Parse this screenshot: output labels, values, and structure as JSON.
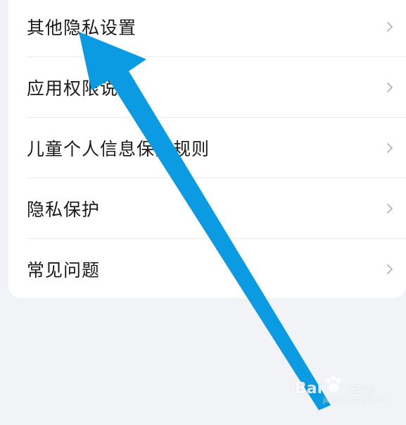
{
  "menu": {
    "items": [
      {
        "label": "其他隐私设置"
      },
      {
        "label": "应用权限说明"
      },
      {
        "label": "儿童个人信息保护规则"
      },
      {
        "label": "隐私保护"
      },
      {
        "label": "常见问题"
      }
    ]
  },
  "icons": {
    "chevron": "chevron-right-icon",
    "arrow": "arrow-annotation-icon",
    "paw": "paw-logo-icon"
  },
  "colors": {
    "background": "#f2f3f7",
    "card": "#ffffff",
    "text": "#1a1a1a",
    "chevron": "#b5b5b5",
    "annotation_arrow": "#0b9be3"
  },
  "watermark": {
    "brand": "Bai",
    "suffix": "经验",
    "url": "jingyan.baidu.com"
  }
}
